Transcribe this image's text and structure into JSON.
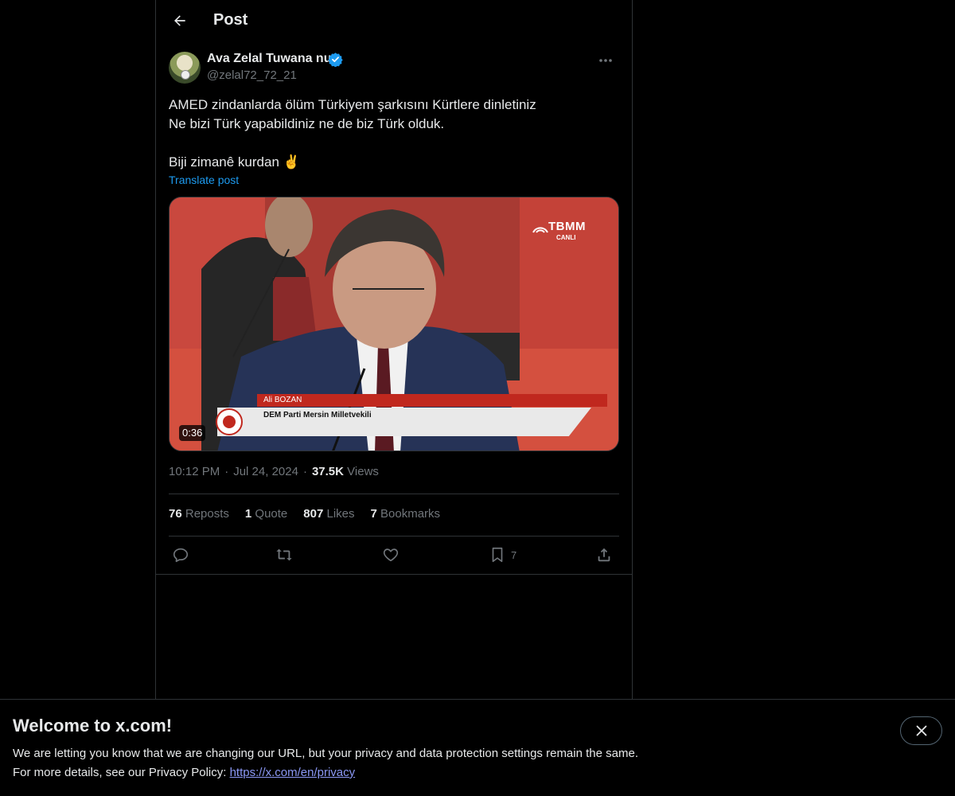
{
  "header": {
    "title": "Post"
  },
  "author": {
    "display_name": "Ava Zelal Tuwana nu",
    "handle": "@zelal72_72_21"
  },
  "post": {
    "lines": [
      "AMED zindanlarda ölüm Türkiyem şarkısını Kürtlere dinletiniz",
      "Ne bizi Türk yapabildiniz ne de biz Türk olduk.",
      "Biji zimanê kurdan ✌️"
    ],
    "translate_label": "Translate post",
    "video": {
      "duration": "0:36",
      "channel_logo": "TBMM",
      "channel_sub": "CANLI",
      "lower_third_name": "Ali BOZAN",
      "lower_third_title": "DEM Parti Mersin Milletvekili"
    },
    "time": "10:12 PM",
    "date": "Jul 24, 2024",
    "views_count": "37.5K",
    "views_label": "Views"
  },
  "stats": {
    "reposts_count": "76",
    "reposts_label": "Reposts",
    "quotes_count": "1",
    "quotes_label": "Quote",
    "likes_count": "807",
    "likes_label": "Likes",
    "bookmarks_count": "7",
    "bookmarks_label": "Bookmarks"
  },
  "actions": {
    "icons": [
      "reply-icon",
      "repost-icon",
      "like-icon",
      "bookmark-icon",
      "share-icon"
    ],
    "bookmark_count": "7"
  },
  "banner": {
    "title": "Welcome to x.com!",
    "line1": "We are letting you know that we are changing our URL, but your privacy and data protection settings remain the same.",
    "line2_prefix": "For more details, see our Privacy Policy: ",
    "link": "https://x.com/en/privacy"
  },
  "colors": {
    "accent": "#1d9bf0",
    "muted": "#71767b",
    "border": "#2f3336",
    "background": "#000000",
    "link": "#8b98f5"
  }
}
